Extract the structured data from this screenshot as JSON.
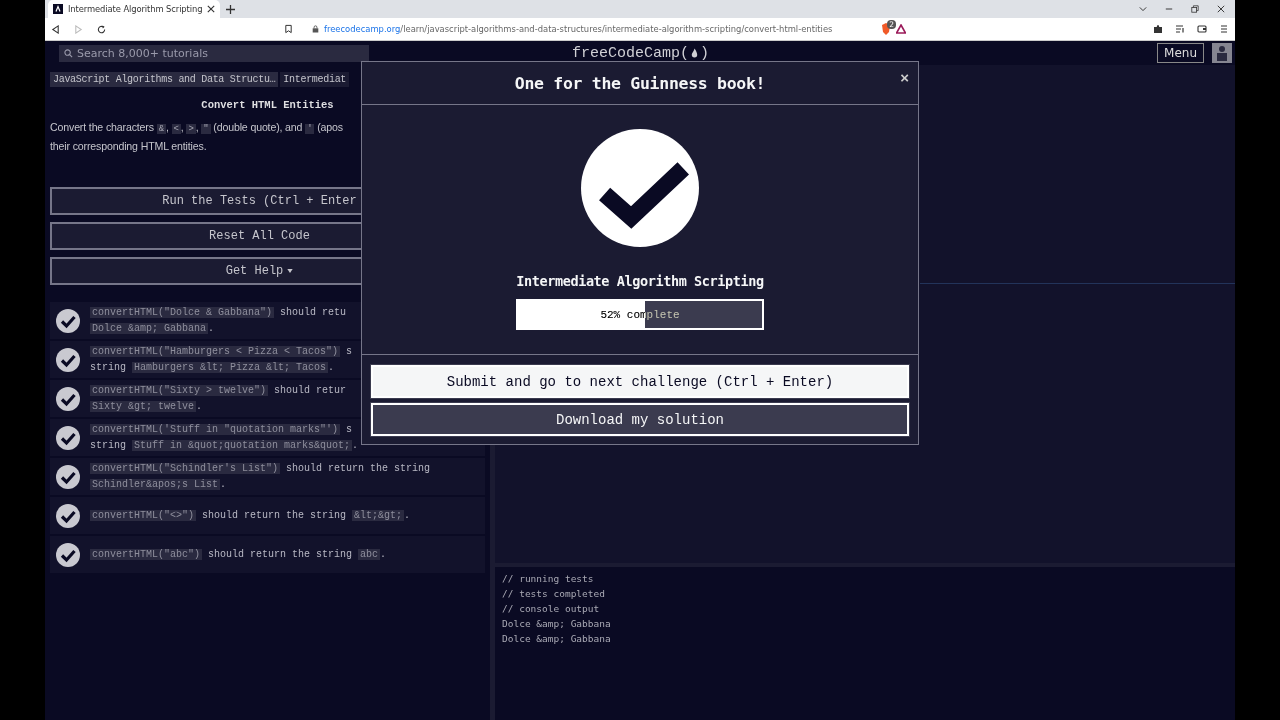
{
  "browser": {
    "tab": {
      "title": "Intermediate Algorithm Scripting",
      "selected": true
    },
    "url": {
      "domain": "freecodecamp.org",
      "path": "/learn/javascript-algorithms-and-data-structures/intermediate-algorithm-scripting/convert-html-entities"
    },
    "shield_badge": "2"
  },
  "nav": {
    "search": {
      "placeholder": "Search 8,000+ tutorials"
    },
    "logo": {
      "text": "freeCodeCamp",
      "open": "(",
      "close": ")"
    },
    "menu": "Menu"
  },
  "lesson": {
    "breadcrumbs": [
      "JavaScript Algorithms and Data Structu…",
      "Intermediat"
    ],
    "title": "Convert HTML Entities",
    "description": [
      [
        {
          "kind": "text",
          "text": "Convert the characters "
        },
        {
          "kind": "code",
          "text": "&"
        },
        {
          "kind": "text",
          "text": ", "
        },
        {
          "kind": "code",
          "text": "<"
        },
        {
          "kind": "text",
          "text": ", "
        },
        {
          "kind": "code",
          "text": ">"
        },
        {
          "kind": "text",
          "text": ", "
        },
        {
          "kind": "code",
          "text": "\""
        },
        {
          "kind": "text",
          "text": " (double quote), and "
        },
        {
          "kind": "code",
          "text": "'"
        },
        {
          "kind": "text",
          "text": " (apos"
        }
      ],
      [
        {
          "kind": "text",
          "text": "their corresponding HTML entities."
        }
      ]
    ],
    "buttons": [
      {
        "label": "Run the Tests (Ctrl + Enter",
        "kind": "plain"
      },
      {
        "label": "Reset All Code",
        "kind": "plain"
      },
      {
        "label": "Get Help",
        "kind": "dropdown"
      }
    ],
    "tests": [
      {
        "passed": true,
        "lines": [
          [
            {
              "kind": "code",
              "text": "convertHTML(\"Dolce & Gabbana\")"
            },
            {
              "kind": "text",
              "text": " should retu"
            }
          ],
          [
            {
              "kind": "code",
              "text": "Dolce &amp; Gabbana"
            },
            {
              "kind": "text",
              "text": "."
            }
          ]
        ]
      },
      {
        "passed": true,
        "lines": [
          [
            {
              "kind": "code",
              "text": "convertHTML(\"Hamburgers < Pizza < Tacos\")"
            },
            {
              "kind": "text",
              "text": " s"
            }
          ],
          [
            {
              "kind": "text",
              "text": "string "
            },
            {
              "kind": "code",
              "text": "Hamburgers &lt; Pizza &lt; Tacos"
            },
            {
              "kind": "text",
              "text": "."
            }
          ]
        ]
      },
      {
        "passed": true,
        "lines": [
          [
            {
              "kind": "code",
              "text": "convertHTML(\"Sixty > twelve\")"
            },
            {
              "kind": "text",
              "text": " should retur"
            }
          ],
          [
            {
              "kind": "code",
              "text": "Sixty &gt; twelve"
            },
            {
              "kind": "text",
              "text": "."
            }
          ]
        ]
      },
      {
        "passed": true,
        "lines": [
          [
            {
              "kind": "code",
              "text": "convertHTML('Stuff in \"quotation marks\"')"
            },
            {
              "kind": "text",
              "text": " s"
            }
          ],
          [
            {
              "kind": "text",
              "text": "string "
            },
            {
              "kind": "code",
              "text": "Stuff in &quot;quotation marks&quot;"
            },
            {
              "kind": "text",
              "text": "."
            }
          ]
        ]
      },
      {
        "passed": true,
        "lines": [
          [
            {
              "kind": "code",
              "text": "convertHTML(\"Schindler's List\")"
            },
            {
              "kind": "text",
              "text": " should return the string"
            }
          ],
          [
            {
              "kind": "code",
              "text": "Schindler&apos;s List"
            },
            {
              "kind": "text",
              "text": "."
            }
          ]
        ]
      },
      {
        "passed": true,
        "lines": [
          [
            {
              "kind": "code",
              "text": "convertHTML(\"<>\")"
            },
            {
              "kind": "text",
              "text": " should return the string "
            },
            {
              "kind": "code",
              "text": "&lt;&gt;"
            },
            {
              "kind": "text",
              "text": "."
            }
          ]
        ]
      },
      {
        "passed": true,
        "lines": [
          [
            {
              "kind": "code",
              "text": "convertHTML(\"abc\")"
            },
            {
              "kind": "text",
              "text": " should return the string "
            },
            {
              "kind": "code",
              "text": "abc"
            },
            {
              "kind": "text",
              "text": "."
            }
          ]
        ]
      }
    ]
  },
  "console": [
    "// running tests",
    "// tests completed",
    "// console output",
    "Dolce &amp; Gabbana",
    "Dolce &amp; Gabbana"
  ],
  "modal": {
    "title": "One for the Guinness book!",
    "close": "×",
    "block": "Intermediate Algorithm Scripting",
    "progress": {
      "level": 0.52,
      "reading": "52% complete"
    },
    "buttons": [
      {
        "label": "Submit and go to next challenge (Ctrl + Enter)",
        "kind": "primary"
      },
      {
        "label": "Download my solution",
        "kind": "secondary"
      }
    ]
  }
}
